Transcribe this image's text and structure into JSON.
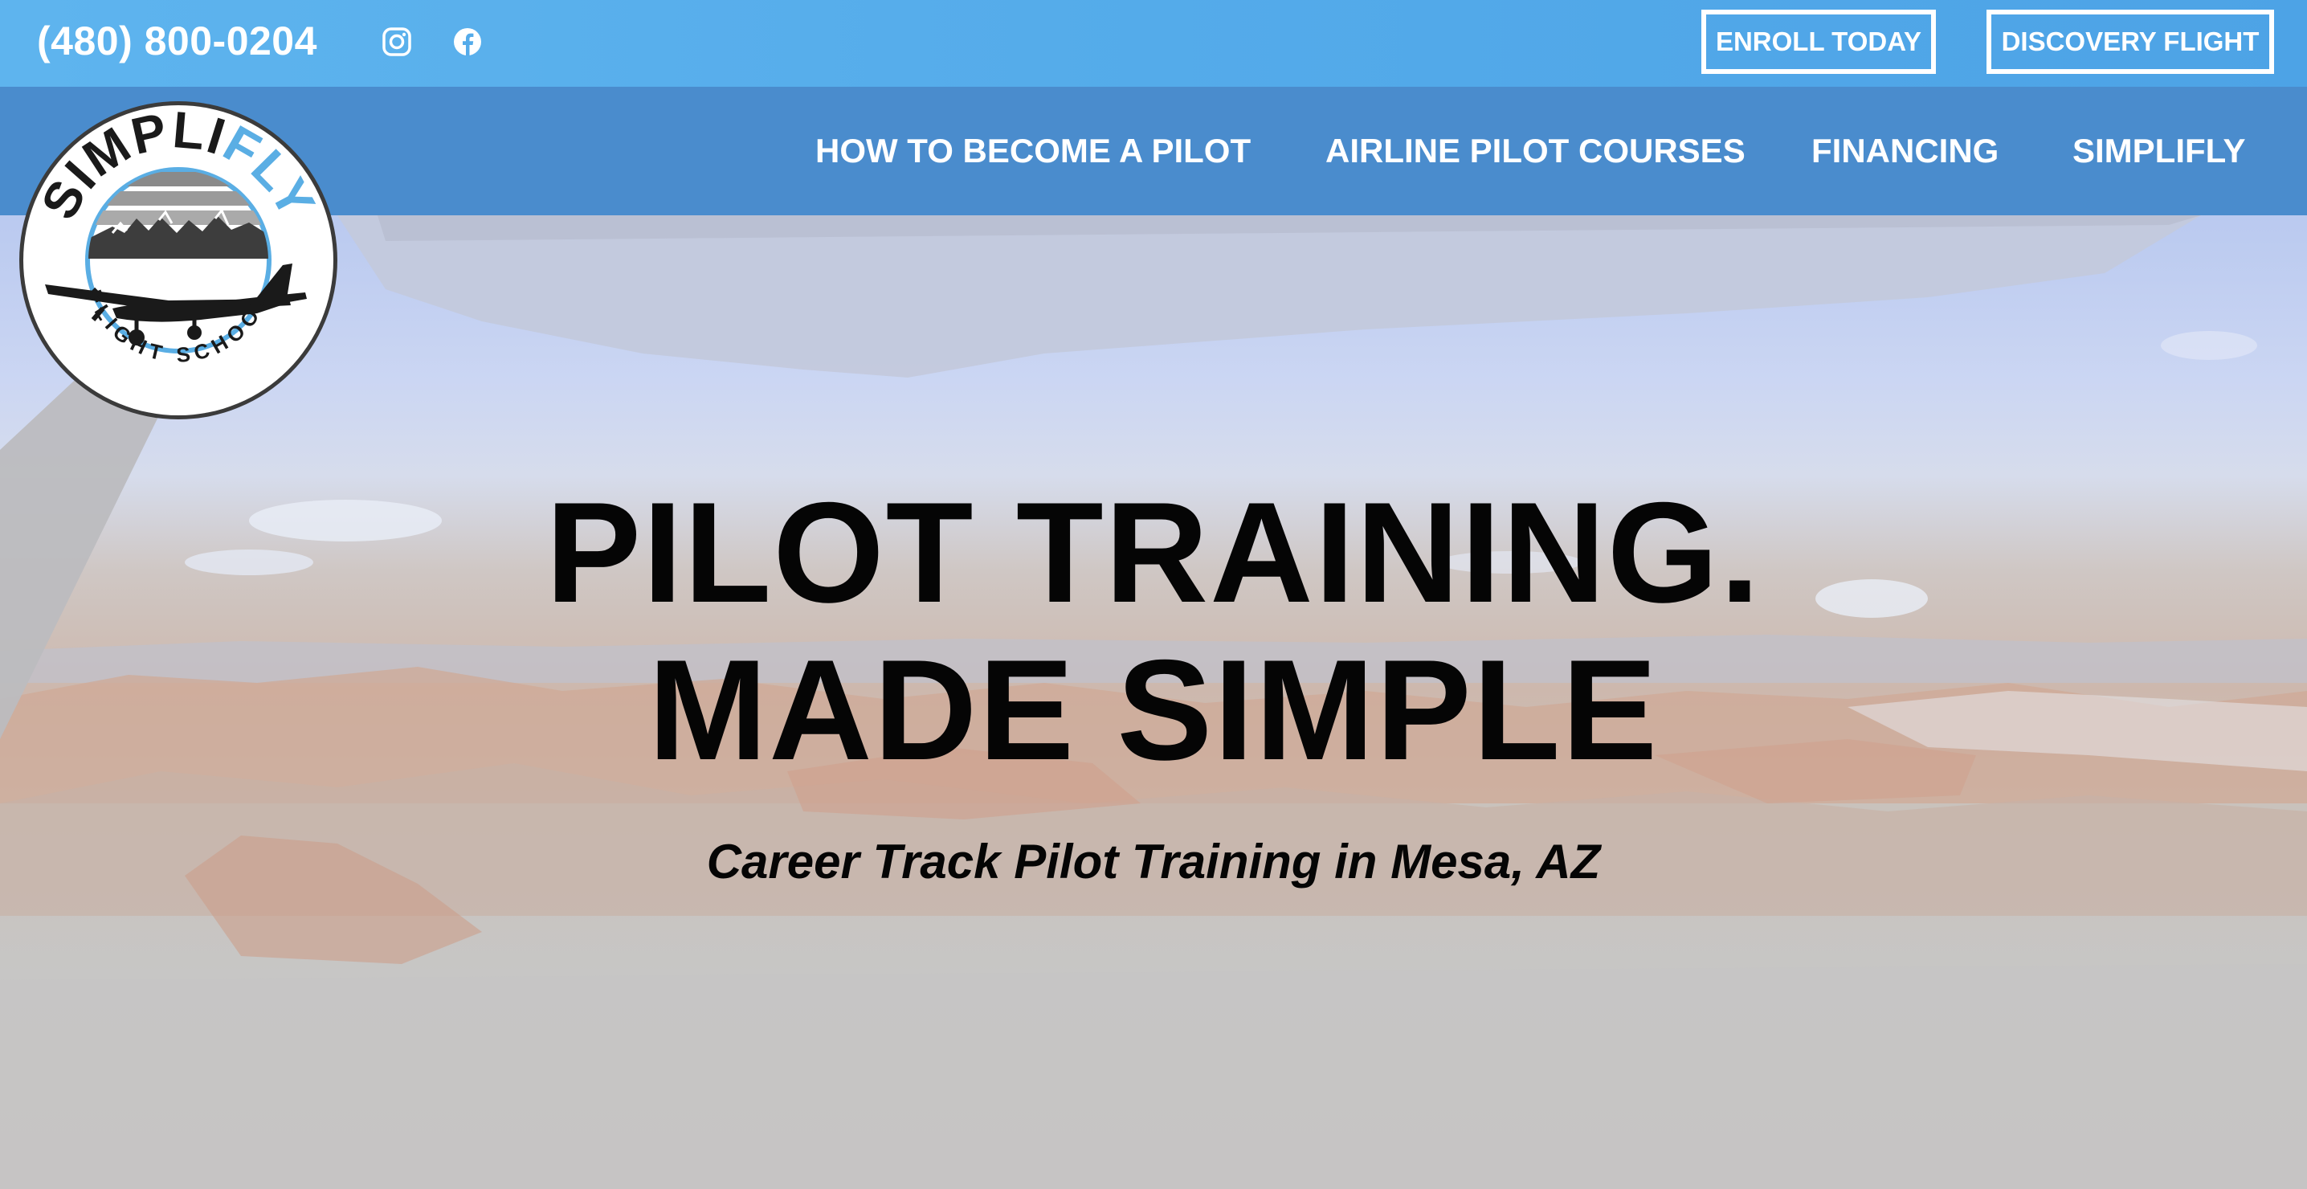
{
  "topbar": {
    "phone": "(480) 800-0204",
    "social_icons": [
      "instagram-icon",
      "facebook-icon"
    ],
    "buttons": {
      "enroll": "ENROLL TODAY",
      "discovery": "DISCOVERY FLIGHT"
    }
  },
  "nav": {
    "items": [
      "HOW TO BECOME A PILOT",
      "AIRLINE PILOT COURSES",
      "FINANCING",
      "SIMPLIFLY"
    ]
  },
  "logo": {
    "brand_top_dark": "SIMPLI",
    "brand_top_accent": "FLY",
    "brand_bottom": "FLIGHT SCHOOL"
  },
  "hero": {
    "headline_line1": "PILOT TRAINING.",
    "headline_line2": "MADE SIMPLE",
    "subheadline": "Career Track Pilot Training in Mesa, AZ"
  },
  "colors": {
    "topbar": "#54abea",
    "navbar": "#4a8ccd",
    "headline_text": "#050505",
    "button_border": "#ffffff"
  }
}
